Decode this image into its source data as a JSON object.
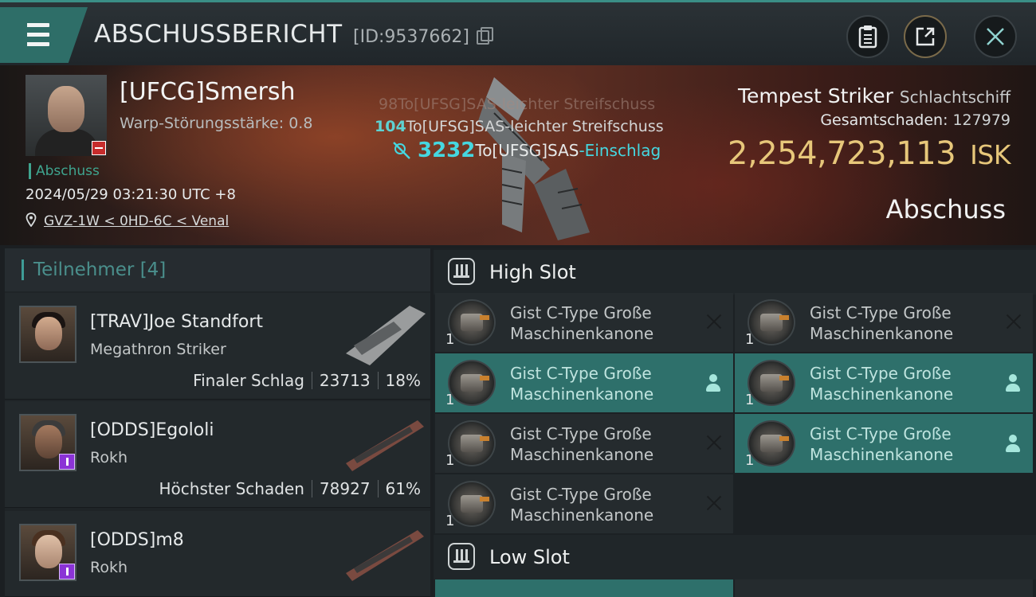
{
  "header": {
    "title": "ABSCHUSSBERICHT",
    "kill_id": "[ID:9537662]",
    "icons": [
      "menu-icon",
      "copy-icon",
      "clipboard-icon",
      "share-icon",
      "close-icon"
    ]
  },
  "victim": {
    "name": "[UFCG]Smersh",
    "warp_strength": "Warp-Störungsstärke: 0.8",
    "tag": "Abschuss",
    "datetime": "2024/05/29 03:21:30 UTC +8",
    "location": "GVZ-1W < 0HD-6C < Venal",
    "ship_name": "Tempest Striker",
    "ship_class": "Schlachtschiff",
    "total_damage_label": "Gesamtschaden:",
    "total_damage_value": "127979",
    "isk_value": "2,254,723,113",
    "isk_currency": "ISK",
    "result": "Abschuss"
  },
  "combat_log": {
    "line1": "98To[UFSG]SAS-leichter Streifschuss",
    "line2_num": "104",
    "line2_text": "To[UFSG]SAS-leichter Streifschuss",
    "line3_num": "3232",
    "line3_target": "To[UFSG]SAS",
    "line3_effect": "-Einschlag"
  },
  "participants": {
    "header": "Teilnehmer [4]",
    "rows": [
      {
        "name": "[TRAV]Joe Standfort",
        "ship": "Megathron Striker",
        "label": "Finaler Schlag",
        "damage": "23713",
        "percent": "18%"
      },
      {
        "name": "[ODDS]Egololi",
        "ship": "Rokh",
        "label": "Höchster Schaden",
        "damage": "78927",
        "percent": "61%"
      },
      {
        "name": "[ODDS]m8",
        "ship": "Rokh",
        "label": "",
        "damage": "",
        "percent": ""
      }
    ]
  },
  "fitting": {
    "high_slot_label": "High Slot",
    "low_slot_label": "Low Slot",
    "module_line1": "Gist C-Type Große",
    "module_line2": "Maschinenkanone",
    "qty": "1",
    "colors": {
      "highlight": "#2e706b",
      "normal": "#252b2e",
      "isk": "#e7c77a",
      "accent": "#3e9d97"
    }
  }
}
